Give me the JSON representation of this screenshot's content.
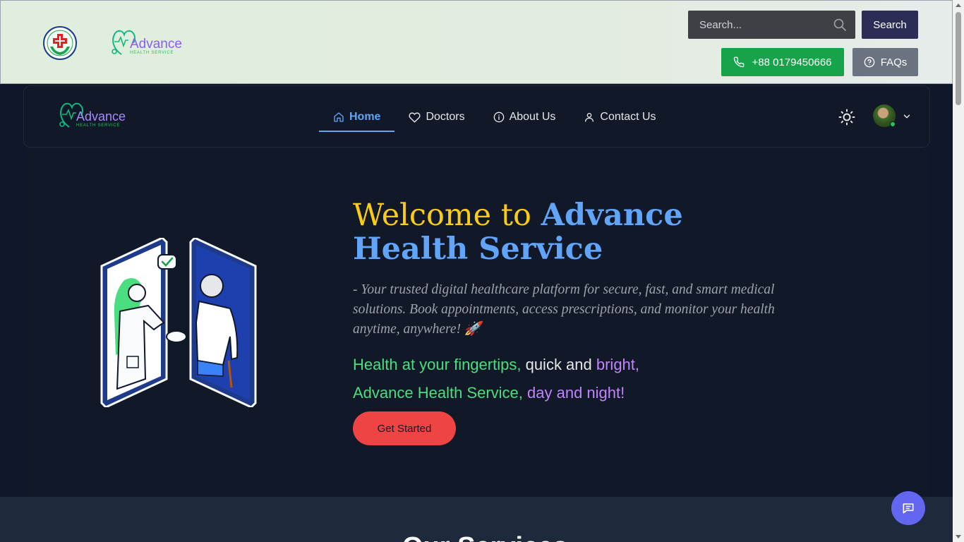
{
  "topbar": {
    "emblem_icon": "red-cross-hands-emblem",
    "brand_logo_text": "Advance",
    "brand_logo_subtext": "HEALTH SERVICE",
    "search": {
      "placeholder": "Search...",
      "value": ""
    },
    "search_button": "Search",
    "phone": "+88 0179450666",
    "faqs": "FAQs"
  },
  "nav": {
    "logo_text": "Advance",
    "logo_subtext": "HEALTH SERVICE",
    "items": [
      {
        "label": "Home",
        "icon": "home-icon",
        "active": true
      },
      {
        "label": "Doctors",
        "icon": "heart-icon",
        "active": false
      },
      {
        "label": "About Us",
        "icon": "info-icon",
        "active": false
      },
      {
        "label": "Contact Us",
        "icon": "user-icon",
        "active": false
      }
    ],
    "theme_icon": "sun-icon",
    "user_status": "online"
  },
  "hero": {
    "title_welcome": "Welcome to ",
    "title_brand": "Advance Health Service",
    "tagline": "- Your trusted digital healthcare platform for secure, fast, and smart medical solutions. Book appointments, access prescriptions, and monitor your health anytime, anywhere! 🚀",
    "poem": {
      "l1_a": "Health at your fingertips,",
      "l1_b": " quick and ",
      "l1_c": "bright,",
      "l2_a": "Advance Health Service,",
      "l2_b": " day and night!"
    },
    "cta": "Get Started"
  },
  "services": {
    "title": "Our Services"
  },
  "colors": {
    "accent_blue": "#60a5fa",
    "accent_yellow": "#facc15",
    "phone_green": "#16a34a",
    "cta_red": "#ef4444",
    "chat_indigo": "#6366f1"
  }
}
